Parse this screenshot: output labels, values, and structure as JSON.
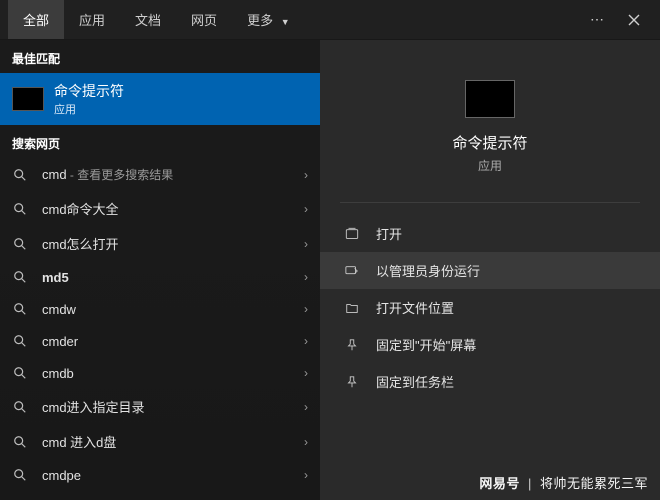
{
  "tabs": {
    "all": "全部",
    "apps": "应用",
    "docs": "文档",
    "web": "网页",
    "more": "更多"
  },
  "sections": {
    "bestMatch": "最佳匹配",
    "webSearch": "搜索网页"
  },
  "bestMatch": {
    "title": "命令提示符",
    "subtitle": "应用"
  },
  "webResults": [
    {
      "query": "cmd",
      "suffix": " - 查看更多搜索结果"
    },
    {
      "query": "cmd命令大全",
      "suffix": ""
    },
    {
      "query": "cmd怎么打开",
      "suffix": ""
    },
    {
      "query": "md5",
      "suffix": ""
    },
    {
      "query": "cmdw",
      "suffix": ""
    },
    {
      "query": "cmder",
      "suffix": ""
    },
    {
      "query": "cmdb",
      "suffix": ""
    },
    {
      "query": "cmd进入指定目录",
      "suffix": ""
    },
    {
      "query": "cmd 进入d盘",
      "suffix": ""
    },
    {
      "query": "cmdpe",
      "suffix": ""
    }
  ],
  "preview": {
    "title": "命令提示符",
    "subtitle": "应用"
  },
  "actions": {
    "open": "打开",
    "runAsAdmin": "以管理员身份运行",
    "openFileLocation": "打开文件位置",
    "pinToStart": "固定到\"开始\"屏幕",
    "pinToTaskbar": "固定到任务栏"
  },
  "watermark": {
    "brand": "网易号",
    "author": "将帅无能累死三军"
  }
}
